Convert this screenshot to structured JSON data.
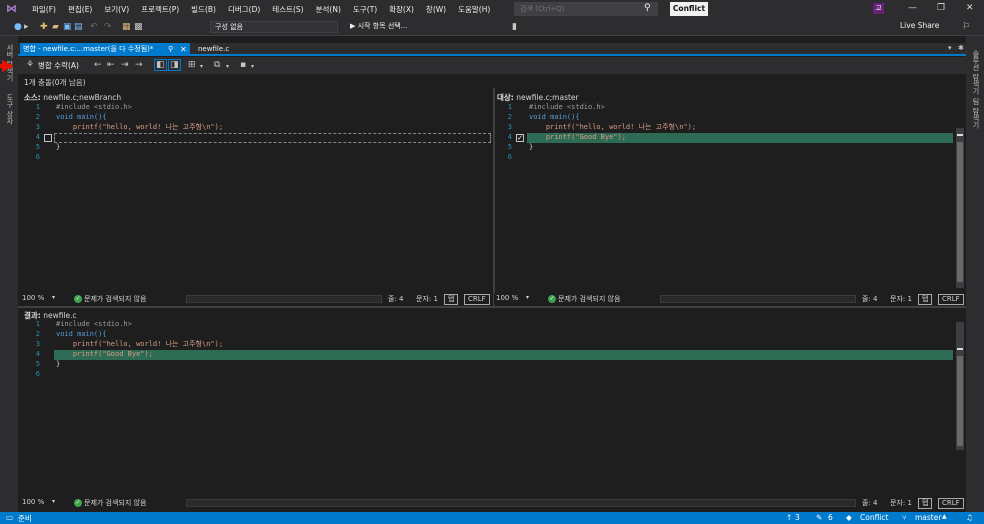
{
  "titlebar": {
    "menu": [
      "파일(F)",
      "편집(E)",
      "보기(V)",
      "프로젝트(P)",
      "빌드(B)",
      "디버그(D)",
      "테스트(S)",
      "분석(N)",
      "도구(T)",
      "확장(X)",
      "창(W)",
      "도움말(H)"
    ],
    "search_placeholder": "검색 (Ctrl+Q)",
    "conflict_label": "Conflict",
    "avatar_initial": "고"
  },
  "toolbar": {
    "config_label": "구성 없음",
    "start_label": "▶ 시작 항목 선택...",
    "live_share_label": "Live Share"
  },
  "left_rail": {
    "items": [
      "서버 탐색기",
      "도구 상자"
    ]
  },
  "right_rail": {
    "items": [
      "솔루션 탐색기",
      "팀 탐색기"
    ]
  },
  "tabs": {
    "active_label": "병합 - newfile.c:...master(을 다 수정됨)*",
    "second_label": "newfile.c"
  },
  "mergebar": {
    "accept_label": "병합 수락(A)"
  },
  "conflicts_label": "1개 충돌(0개 남음)",
  "source": {
    "label": "소스:",
    "name": "newfile.c;newBranch",
    "lines": [
      "#include <stdio.h>",
      "void main(){",
      "    printf(\"hello, world! 나는 고주형\\n\");",
      "",
      "}",
      ""
    ]
  },
  "target": {
    "label": "대상:",
    "name": "newfile.c;master",
    "lines": [
      "#include <stdio.h>",
      "void main(){",
      "    printf(\"hello, world! 나는 고주형\\n\");",
      "    printf(\"Good Bye\");",
      "}",
      ""
    ]
  },
  "result": {
    "label": "결과:",
    "name": "newfile.c",
    "lines": [
      "#include <stdio.h>",
      "void main(){",
      "    printf(\"hello, world! 나는 고주형\\n\");",
      "    printf(\"Good Bye\");",
      "}",
      ""
    ]
  },
  "line_numbers": [
    "1",
    "2",
    "3",
    "4",
    "5",
    "6"
  ],
  "editor_status": {
    "zoom": "100 %",
    "no_issues": "문제가 검색되지 않음",
    "line": "줄: 4",
    "col": "문자: 1",
    "tab": "탭",
    "eol": "CRLF"
  },
  "statusbar": {
    "ready": "준비",
    "up_count": "3",
    "edit_count": "6",
    "repo": "Conflict",
    "branch": "master"
  },
  "colors": {
    "accent": "#007acc",
    "diff_highlight": "#2e6b55",
    "arrow": "#e51400"
  }
}
